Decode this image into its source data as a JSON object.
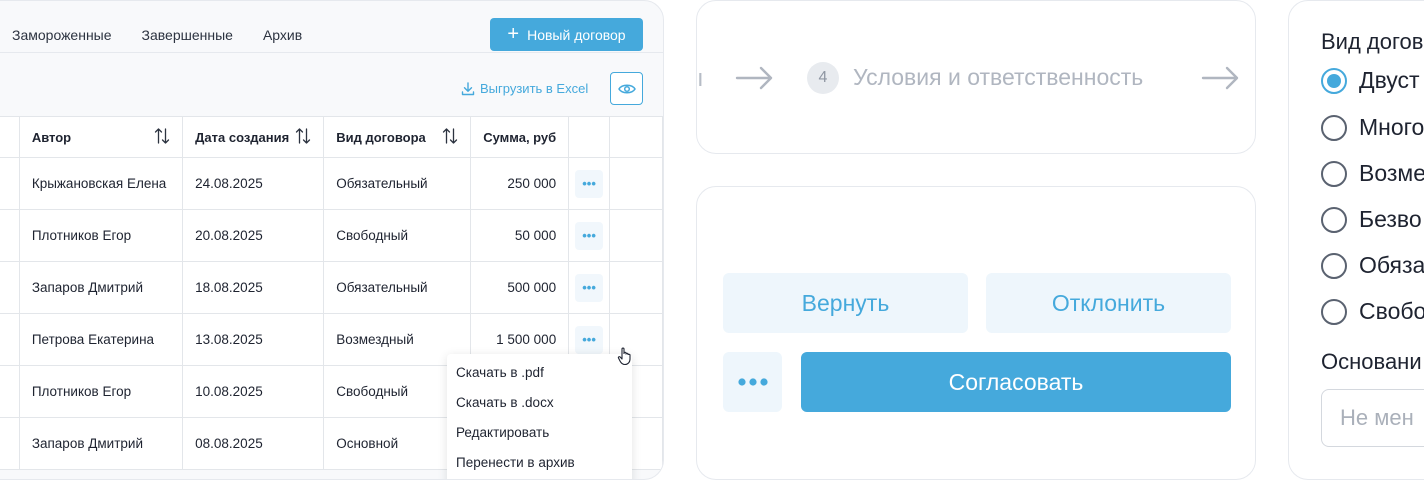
{
  "tabs": [
    "Замороженные",
    "Завершенные",
    "Архив"
  ],
  "toolbar": {
    "new_contract_label": "Новый договор",
    "export_label": "Выгрузить в Excel"
  },
  "table": {
    "columns": [
      "Автор",
      "Дата создания",
      "Вид договора",
      "Сумма, руб"
    ],
    "rows": [
      {
        "author": "Крыжановская Елена",
        "date": "24.08.2025",
        "type": "Обязательный",
        "sum": "250 000"
      },
      {
        "author": "Плотников Егор",
        "date": "20.08.2025",
        "type": "Свободный",
        "sum": "50 000"
      },
      {
        "author": "Запаров Дмитрий",
        "date": "18.08.2025",
        "type": "Обязательный",
        "sum": "500 000"
      },
      {
        "author": "Петрова Екатерина",
        "date": "13.08.2025",
        "type": "Возмездный",
        "sum": "1 500 000"
      },
      {
        "author": "Плотников Егор",
        "date": "10.08.2025",
        "type": "Свободный",
        "sum": ""
      },
      {
        "author": "Запаров Дмитрий",
        "date": "08.08.2025",
        "type": "Основной",
        "sum": ""
      }
    ],
    "row_action": "•••"
  },
  "context_menu": [
    "Скачать в .pdf",
    "Скачать в .docx",
    "Редактировать",
    "Перенести в архив"
  ],
  "stepper": {
    "left_fragment": "ı",
    "step_number": "4",
    "step_label": "Условия и ответственность"
  },
  "actions": {
    "return_label": "Вернуть",
    "reject_label": "Отклонить",
    "approve_label": "Согласовать"
  },
  "form": {
    "title": "Вид догов",
    "options": [
      {
        "label": "Двуст",
        "checked": true
      },
      {
        "label": "Много",
        "checked": false
      },
      {
        "label": "Возме",
        "checked": false
      },
      {
        "label": "Безво",
        "checked": false
      },
      {
        "label": "Обяза",
        "checked": false
      },
      {
        "label": "Свобо",
        "checked": false
      }
    ],
    "basis_title": "Основани",
    "basis_placeholder": "Не мен"
  },
  "colors": {
    "accent": "#45a9dc",
    "accent_light": "#eef6fc",
    "border": "#e6e9ee"
  }
}
